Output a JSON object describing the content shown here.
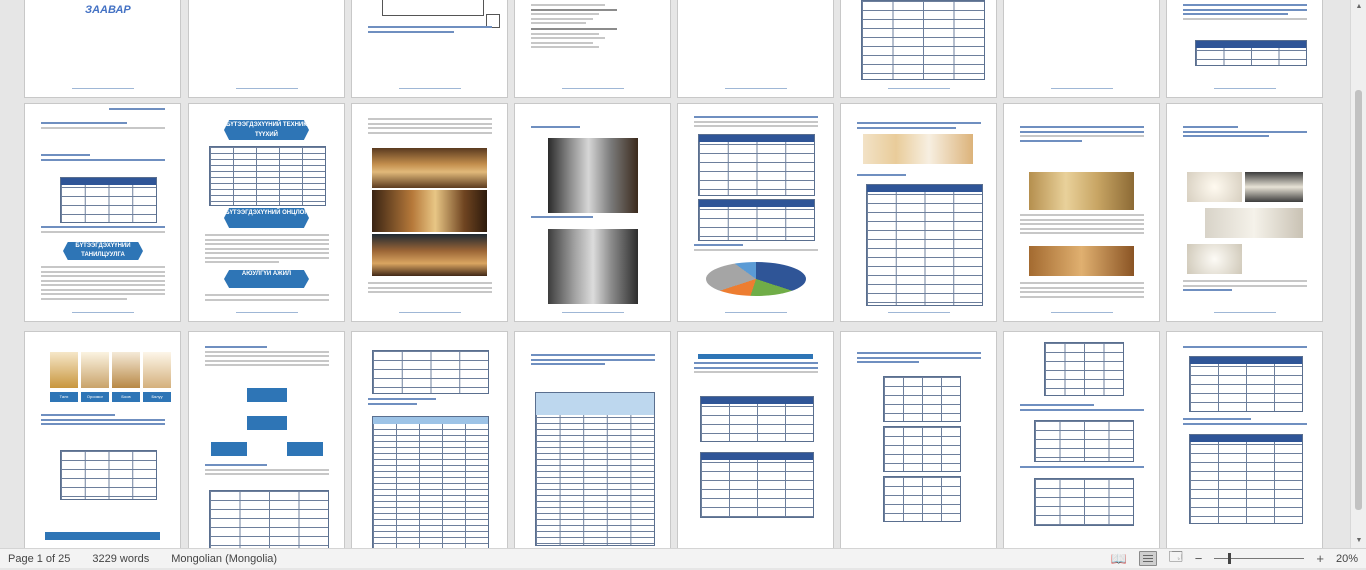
{
  "document": {
    "cover_title": "ЗААВАР",
    "banner_texts": [
      "БҮТЭЭГДЭХҮҮНИЙ ТЕХНИК ТҮҮХИЙ",
      "БҮТЭЭГДЭХҮҮНИЙ ОНЦЛОГ",
      "БҮТЭЭГДЭХҮҮНИЙ ТАНИЛЦУУЛГА",
      "АЮУЛГҮЙ АЖИЛ"
    ],
    "product_tiles": [
      "Талх",
      "Ороомог",
      "Боов",
      "Бялуу"
    ]
  },
  "status_bar": {
    "page_indicator": "Page 1 of 25",
    "word_count": "3229 words",
    "language": "Mongolian (Mongolia)",
    "zoom_level": "20%",
    "zoom_minus": "−",
    "zoom_plus": "+"
  }
}
